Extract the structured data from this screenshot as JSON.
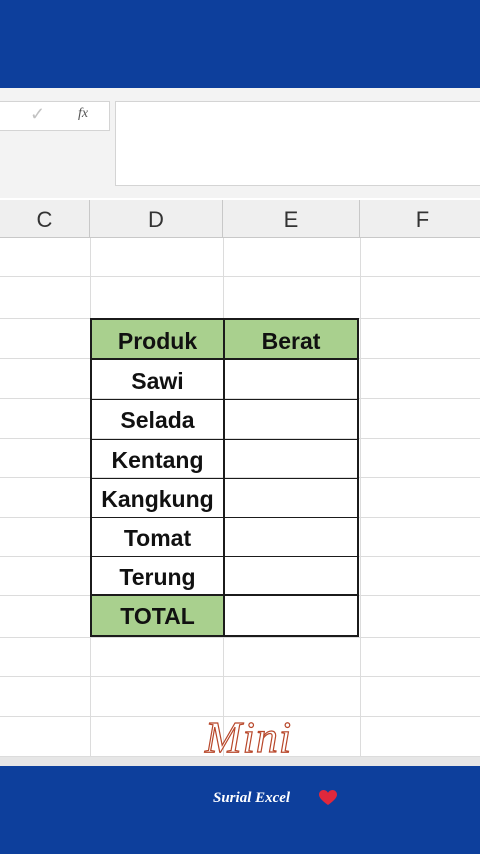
{
  "formula_bar": {
    "enter_icon": "checkmark-icon",
    "fx_label": "fx",
    "formula_value": ""
  },
  "columns": [
    "C",
    "D",
    "E",
    "F"
  ],
  "table": {
    "headers": [
      "Produk",
      "Berat"
    ],
    "rows": [
      {
        "produk": "Sawi",
        "berat": ""
      },
      {
        "produk": "Selada",
        "berat": ""
      },
      {
        "produk": "Kentang",
        "berat": ""
      },
      {
        "produk": "Kangkung",
        "berat": ""
      },
      {
        "produk": "Tomat",
        "berat": ""
      },
      {
        "produk": "Terung",
        "berat": ""
      }
    ],
    "total_label": "TOTAL",
    "total_value": ""
  },
  "watermark": {
    "script_text": "Mini",
    "subtitle": "Surial Excel",
    "heart_icon": "heart-icon"
  },
  "colors": {
    "band": "#0d3f9c",
    "header_fill": "#a9d08e",
    "heart": "#e0283c"
  }
}
